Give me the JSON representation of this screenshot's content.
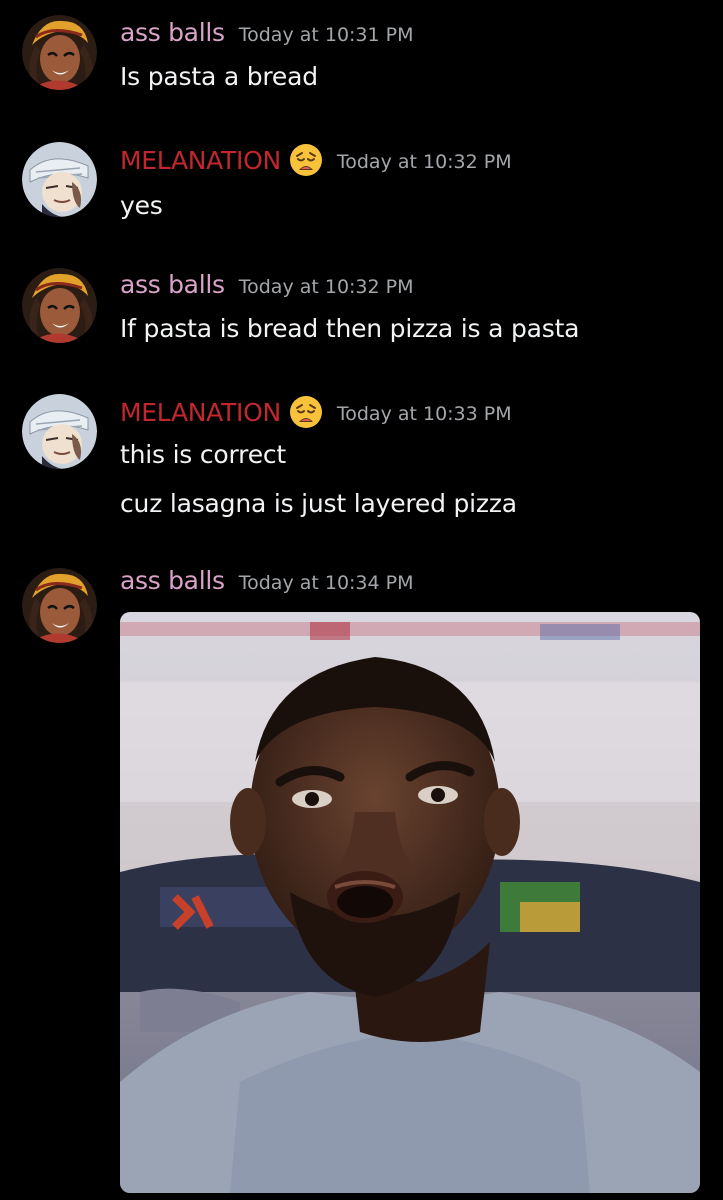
{
  "users": {
    "assballs": {
      "name": "ass balls",
      "name_color": "#d9a2c9",
      "avatar_icon": "cartoon-girl-headwrap-avatar"
    },
    "melanation": {
      "name": "MELANATION",
      "name_color": "#c1272d",
      "avatar_icon": "anime-bandaged-head-avatar",
      "badge_icon": "weary-face-emoji"
    }
  },
  "messages": [
    {
      "author": "ass balls",
      "time": "Today at 10:31 PM",
      "lines": [
        "Is pasta a bread"
      ]
    },
    {
      "author": "MELANATION",
      "time": "Today at 10:32 PM",
      "lines": [
        "yes"
      ]
    },
    {
      "author": "ass balls",
      "time": "Today at 10:32 PM",
      "lines": [
        "If pasta is bread then pizza is a pasta"
      ]
    },
    {
      "author": "MELANATION",
      "time": "Today at 10:33 PM",
      "lines": [
        "this is correct",
        "cuz lasagna is just layered pizza"
      ]
    },
    {
      "author": "ass balls",
      "time": "Today at 10:34 PM",
      "lines": [],
      "attachment": "confused-man-reaction-gif"
    }
  ],
  "colors": {
    "background": "#000000",
    "text": "#f2f3f5",
    "timestamp": "#a3a6aa"
  }
}
